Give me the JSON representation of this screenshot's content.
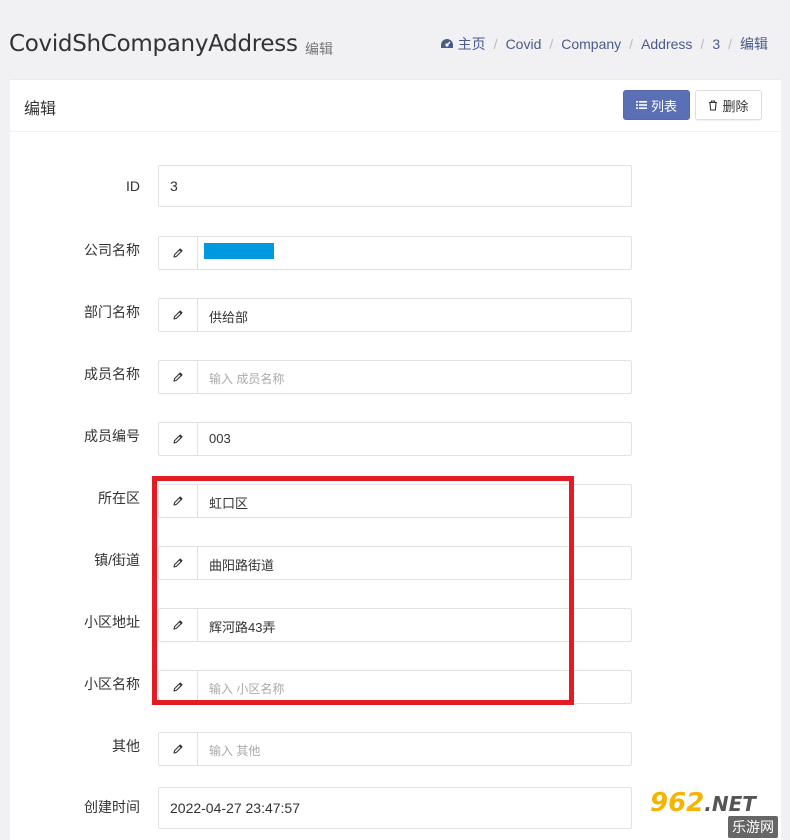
{
  "header": {
    "title": "CovidShCompanyAddress",
    "subtitle": "编辑",
    "breadcrumb": [
      "主页",
      "Covid",
      "Company",
      "Address",
      "3",
      "编辑"
    ]
  },
  "box": {
    "title": "编辑",
    "list_button": "列表",
    "delete_button": "删除"
  },
  "form": {
    "id": {
      "label": "ID",
      "value": "3"
    },
    "company_name": {
      "label": "公司名称",
      "value": ""
    },
    "dept_name": {
      "label": "部门名称",
      "value": "供给部"
    },
    "member_name": {
      "label": "成员名称",
      "value": "",
      "placeholder": "输入 成员名称"
    },
    "member_no": {
      "label": "成员编号",
      "value": "003"
    },
    "district": {
      "label": "所在区",
      "value": "虹口区"
    },
    "street": {
      "label": "镇/街道",
      "value": "曲阳路街道"
    },
    "community_addr": {
      "label": "小区地址",
      "value": "辉河路43弄"
    },
    "community_name": {
      "label": "小区名称",
      "value": "",
      "placeholder": "输入 小区名称"
    },
    "other": {
      "label": "其他",
      "value": "",
      "placeholder": "输入 其他"
    },
    "created_at": {
      "label": "创建时间",
      "value": "2022-04-27 23:47:57"
    }
  },
  "watermark": {
    "main": "962",
    "suffix": ".NET",
    "sub": "乐游网"
  },
  "colors": {
    "primary": "#5b6fb5",
    "highlight": "#e31b23",
    "redaction": "#0099e0"
  }
}
